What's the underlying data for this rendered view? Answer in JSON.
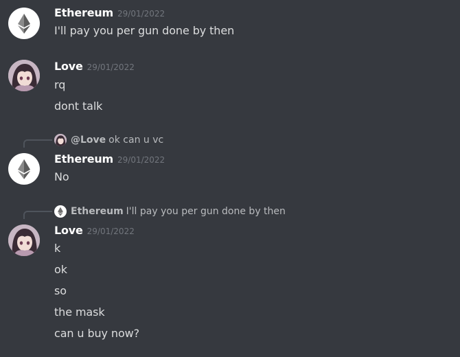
{
  "messages": [
    {
      "author": "Ethereum",
      "timestamp": "29/01/2022",
      "lines": [
        "I'll pay you per gun done by then"
      ]
    },
    {
      "author": "Love",
      "timestamp": "29/01/2022",
      "lines": [
        "rq",
        "dont talk"
      ]
    },
    {
      "reply": {
        "author": "@Love",
        "text": "ok can u vc"
      },
      "author": "Ethereum",
      "timestamp": "29/01/2022",
      "lines": [
        "No"
      ]
    },
    {
      "reply": {
        "author": "Ethereum",
        "text": "I'll pay you per gun done by then"
      },
      "author": "Love",
      "timestamp": "29/01/2022",
      "lines": [
        "k",
        "ok",
        "so",
        "the mask",
        "can u buy now?"
      ]
    }
  ],
  "icons": {
    "ethereum_avatar": "ethereum-logo-icon",
    "love_avatar": "anime-girl-avatar"
  },
  "colors": {
    "background": "#36393f",
    "username": "#ffffff",
    "message_text": "#dcddde",
    "timestamp": "#72767d",
    "reply_text": "#b9bbbe"
  }
}
